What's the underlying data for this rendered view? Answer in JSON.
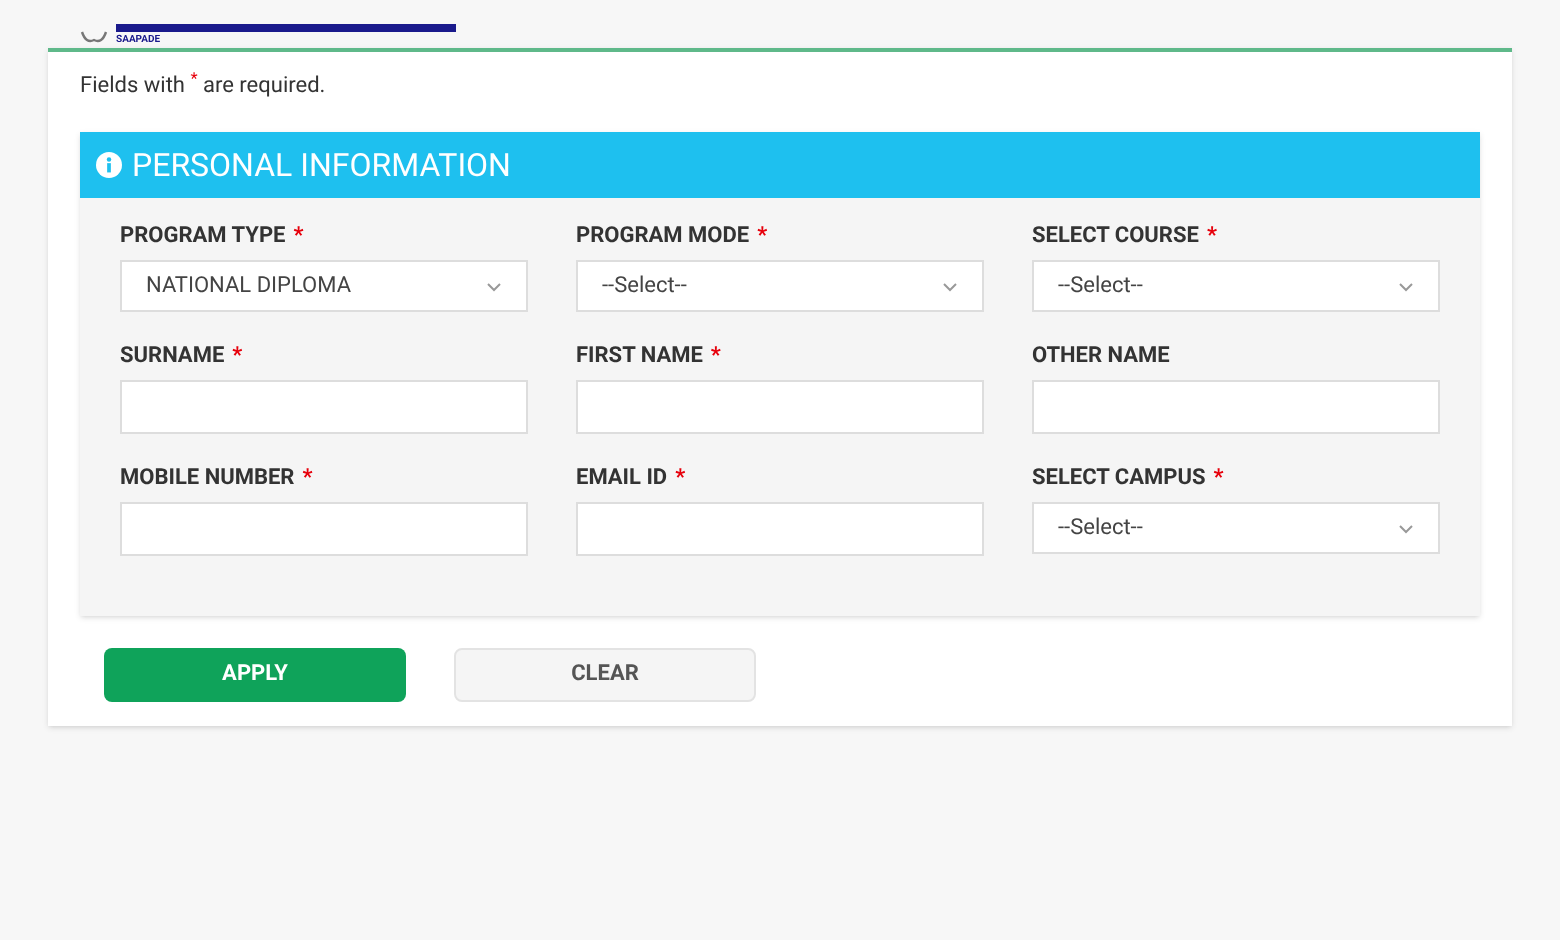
{
  "logo": {
    "caption": "SAAPADE"
  },
  "note": "Fields with $^{*}$ are required.",
  "section": {
    "title": "PERSONAL INFORMATION"
  },
  "fields": [
    {
      "label": "PROGRAM TYPE",
      "mark": "*",
      "kind": "select",
      "value": "NATIONAL DIPLOMA"
    },
    {
      "label": "PROGRAM MODE",
      "mark": "*",
      "kind": "select",
      "value": "--Select--"
    },
    {
      "label": "SELECT COURSE",
      "mark": "*",
      "kind": "select",
      "value": "--Select--"
    },
    {
      "label": "SURNAME",
      "mark": "*",
      "kind": "text"
    },
    {
      "label": "FIRST NAME",
      "mark": "*",
      "kind": "text"
    },
    {
      "label": "OTHER NAME",
      "kind": "text"
    },
    {
      "label": "MOBILE NUMBER",
      "mark": "*",
      "kind": "text"
    },
    {
      "label": "EMAIL ID",
      "mark": "*",
      "kind": "text"
    },
    {
      "label": "SELECT CAMPUS",
      "mark": "*",
      "kind": "select",
      "value": "--Select--"
    }
  ],
  "buttons": [
    {
      "label": "APPLY",
      "kind": "primary"
    },
    {
      "label": "CLEAR",
      "kind": "secondary"
    }
  ]
}
